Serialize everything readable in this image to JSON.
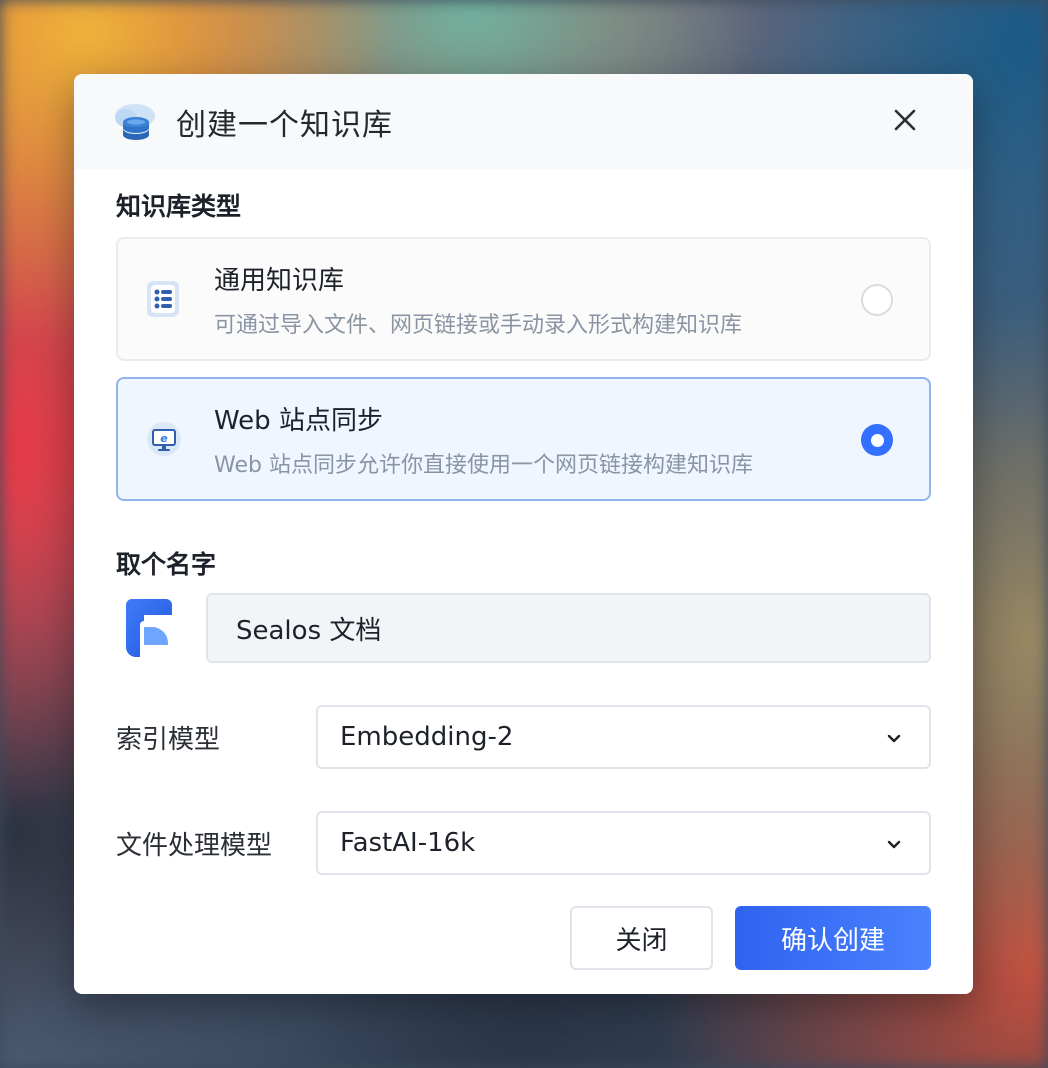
{
  "modal": {
    "title": "创建一个知识库",
    "header_icon": "database-cloud-icon",
    "close_icon": "close-icon"
  },
  "type_section": {
    "label": "知识库类型",
    "options": [
      {
        "title": "通用知识库",
        "description": "可通过导入文件、网页链接或手动录入形式构建知识库",
        "icon": "list-database-icon",
        "selected": false
      },
      {
        "title": "Web 站点同步",
        "description": "Web 站点同步允许你直接使用一个网页链接构建知识库",
        "icon": "web-monitor-icon",
        "selected": true
      }
    ]
  },
  "name_section": {
    "label": "取个名字",
    "value": "Sealos 文档",
    "logo_icon": "fastgpt-logo"
  },
  "fields": {
    "index_model": {
      "label": "索引模型",
      "value": "Embedding-2"
    },
    "file_model": {
      "label": "文件处理模型",
      "value": "FastAI-16k"
    }
  },
  "footer": {
    "close_label": "关闭",
    "confirm_label": "确认创建"
  },
  "colors": {
    "primary": "#3370ff",
    "selected_border": "#90b4ee",
    "selected_bg": "#f0f6ff"
  }
}
